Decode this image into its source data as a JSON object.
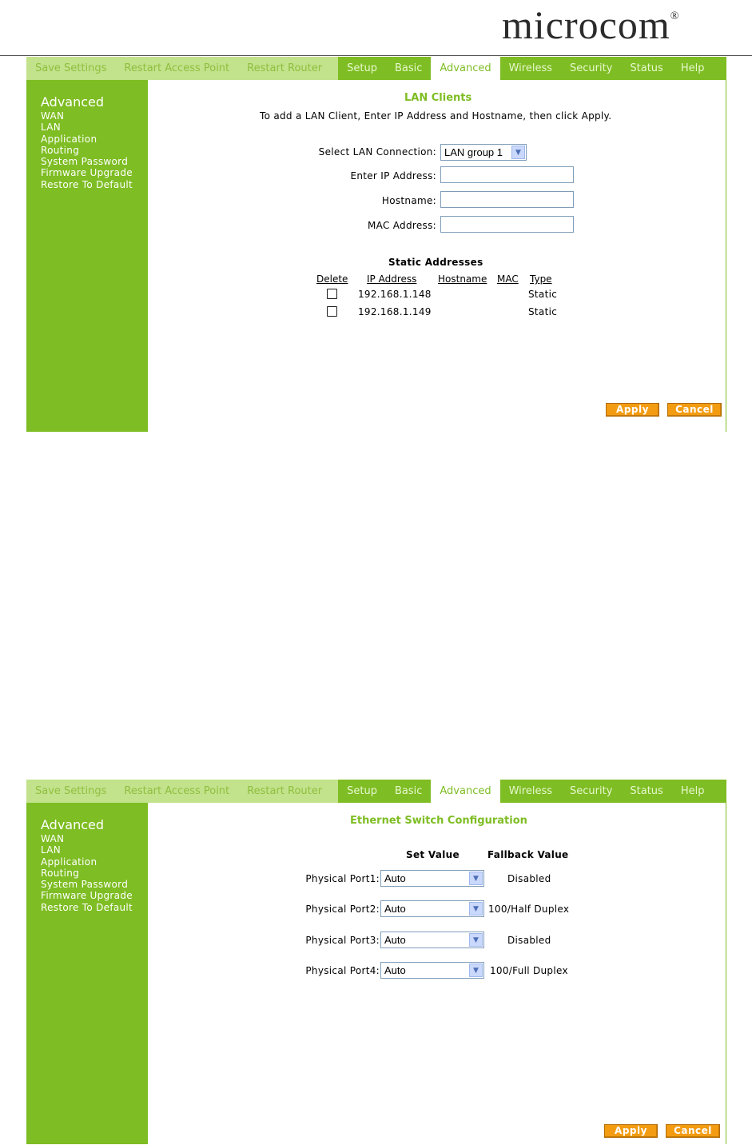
{
  "brand": {
    "name": "microcom",
    "reg": "®"
  },
  "nav": {
    "save_settings": "Save Settings",
    "restart_ap": "Restart Access Point",
    "restart_router": "Restart Router",
    "setup": "Setup",
    "basic": "Basic",
    "advanced": "Advanced",
    "wireless": "Wireless",
    "security": "Security",
    "status": "Status",
    "help": "Help"
  },
  "sidebar": {
    "title": "Advanced",
    "items": [
      "WAN",
      "LAN",
      "Application",
      "Routing",
      "System Password",
      "Firmware Upgrade",
      "Restore To Default"
    ]
  },
  "lan_clients": {
    "title": "LAN Clients",
    "instruction": "To add a LAN Client, Enter IP Address and Hostname, then click Apply.",
    "select_label": "Select LAN Connection:",
    "select_value": "LAN group 1",
    "ip_label": "Enter IP Address:",
    "hostname_label": "Hostname:",
    "mac_label": "MAC Address:",
    "ip_value": "",
    "hostname_value": "",
    "mac_value": "",
    "static_title": "Static Addresses",
    "columns": [
      "Delete",
      "IP Address",
      "Hostname",
      "MAC",
      "Type"
    ],
    "rows": [
      {
        "ip": "192.168.1.148",
        "hostname": "",
        "mac": "",
        "type": "Static"
      },
      {
        "ip": "192.168.1.149",
        "hostname": "",
        "mac": "",
        "type": "Static"
      }
    ],
    "apply": "Apply",
    "cancel": "Cancel"
  },
  "ethernet": {
    "title": "Ethernet Switch Configuration",
    "set_value_header": "Set Value",
    "fallback_header": "Fallback Value",
    "ports": [
      {
        "label": "Physical Port1:",
        "value": "Auto",
        "fallback": "Disabled"
      },
      {
        "label": "Physical Port2:",
        "value": "Auto",
        "fallback": "100/Half Duplex"
      },
      {
        "label": "Physical Port3:",
        "value": "Auto",
        "fallback": "Disabled"
      },
      {
        "label": "Physical Port4:",
        "value": "Auto",
        "fallback": "100/Full Duplex"
      }
    ],
    "apply": "Apply",
    "cancel": "Cancel"
  },
  "colors": {
    "brand_green": "#7ebd23",
    "light_green": "#c2e28b",
    "button_orange": "#f39c12"
  }
}
